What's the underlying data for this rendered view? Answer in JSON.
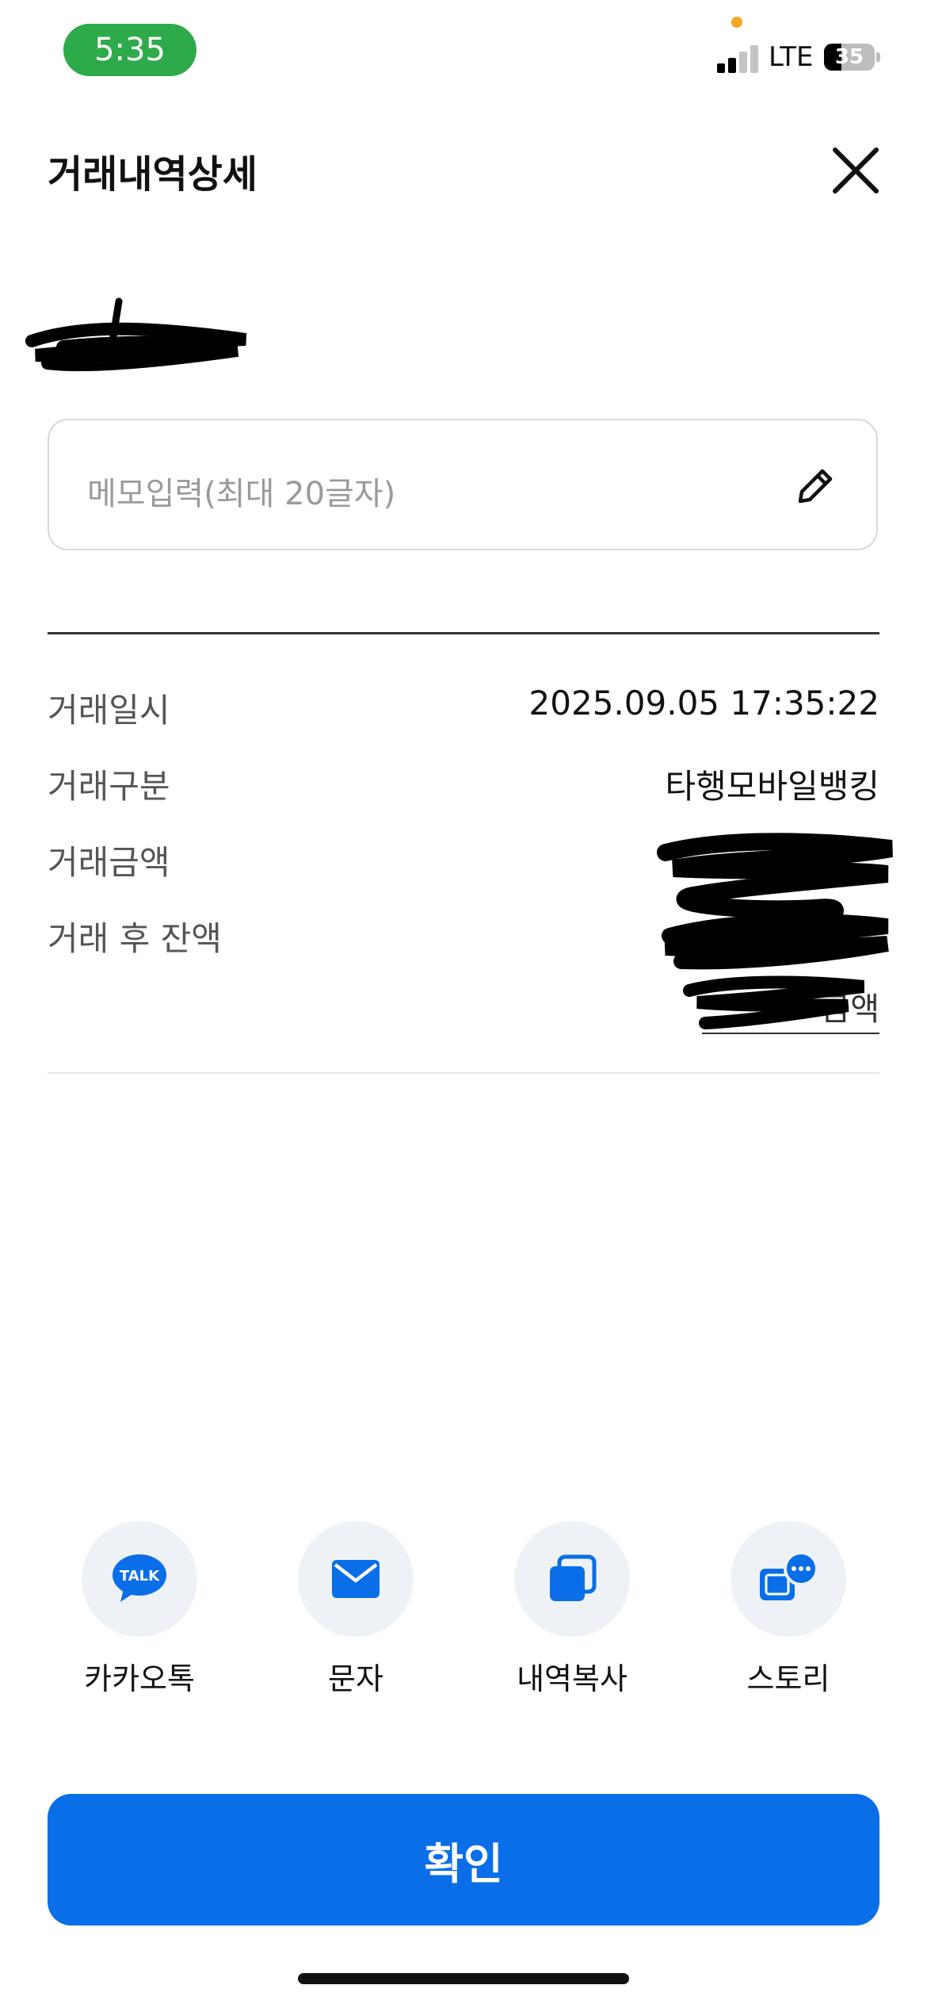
{
  "status_bar": {
    "time": "5:35",
    "network": "LTE",
    "battery_level": "35",
    "battery_fraction": 0.35,
    "signal_bars_active": 2,
    "signal_bars_total": 4
  },
  "header": {
    "title": "거래내역상세",
    "close_icon": "close-icon"
  },
  "memo": {
    "placeholder": "메모입력(최대 20글자)",
    "edit_icon": "pencil-icon"
  },
  "details": [
    {
      "label": "거래일시",
      "value": "2025.09.05 17:35:22"
    },
    {
      "label": "거래구분",
      "value": "타행모바일뱅킹"
    },
    {
      "label": "거래금액",
      "value": ""
    },
    {
      "label": "거래 후 잔액",
      "value": ""
    }
  ],
  "balance_link_suffix": "금액",
  "share": [
    {
      "label": "카카오톡",
      "icon": "kakaotalk-icon",
      "icon_text": "TALK"
    },
    {
      "label": "문자",
      "icon": "envelope-icon"
    },
    {
      "label": "내역복사",
      "icon": "copy-icon"
    },
    {
      "label": "스토리",
      "icon": "story-icon"
    }
  ],
  "confirm_label": "확인",
  "colors": {
    "primary": "#0a6ee8",
    "time_pill": "#2daa4a",
    "icon_bg": "#eef2f7",
    "label_gray": "#555555",
    "placeholder_gray": "#9a9a9a"
  }
}
